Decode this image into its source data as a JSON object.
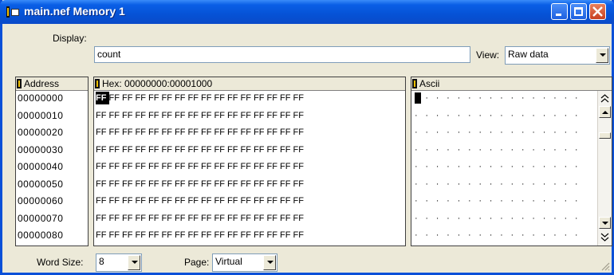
{
  "window": {
    "title": "main.nef Memory 1",
    "controls": {
      "minimize": "minimize-icon",
      "maximize": "maximize-icon",
      "close": "close-icon"
    }
  },
  "display": {
    "label": "Display:",
    "value": "count"
  },
  "view": {
    "label": "View:",
    "selected": "Raw data"
  },
  "address_panel": {
    "header": "Address",
    "rows": [
      "00000000",
      "00000010",
      "00000020",
      "00000030",
      "00000040",
      "00000050",
      "00000060",
      "00000070",
      "00000080"
    ]
  },
  "hex_panel": {
    "header": "Hex: 00000000:00001000",
    "byte": "FF",
    "bytes_per_row": 16,
    "selected_byte": "FF"
  },
  "ascii_panel": {
    "header": "Ascii",
    "char": "·"
  },
  "word_size": {
    "label": "Word Size:",
    "selected": "8"
  },
  "page": {
    "label": "Page:",
    "selected": "Virtual"
  },
  "colors": {
    "title_bar": "#0552d6",
    "window_bg": "#ece9d8",
    "selection": "#000000"
  }
}
